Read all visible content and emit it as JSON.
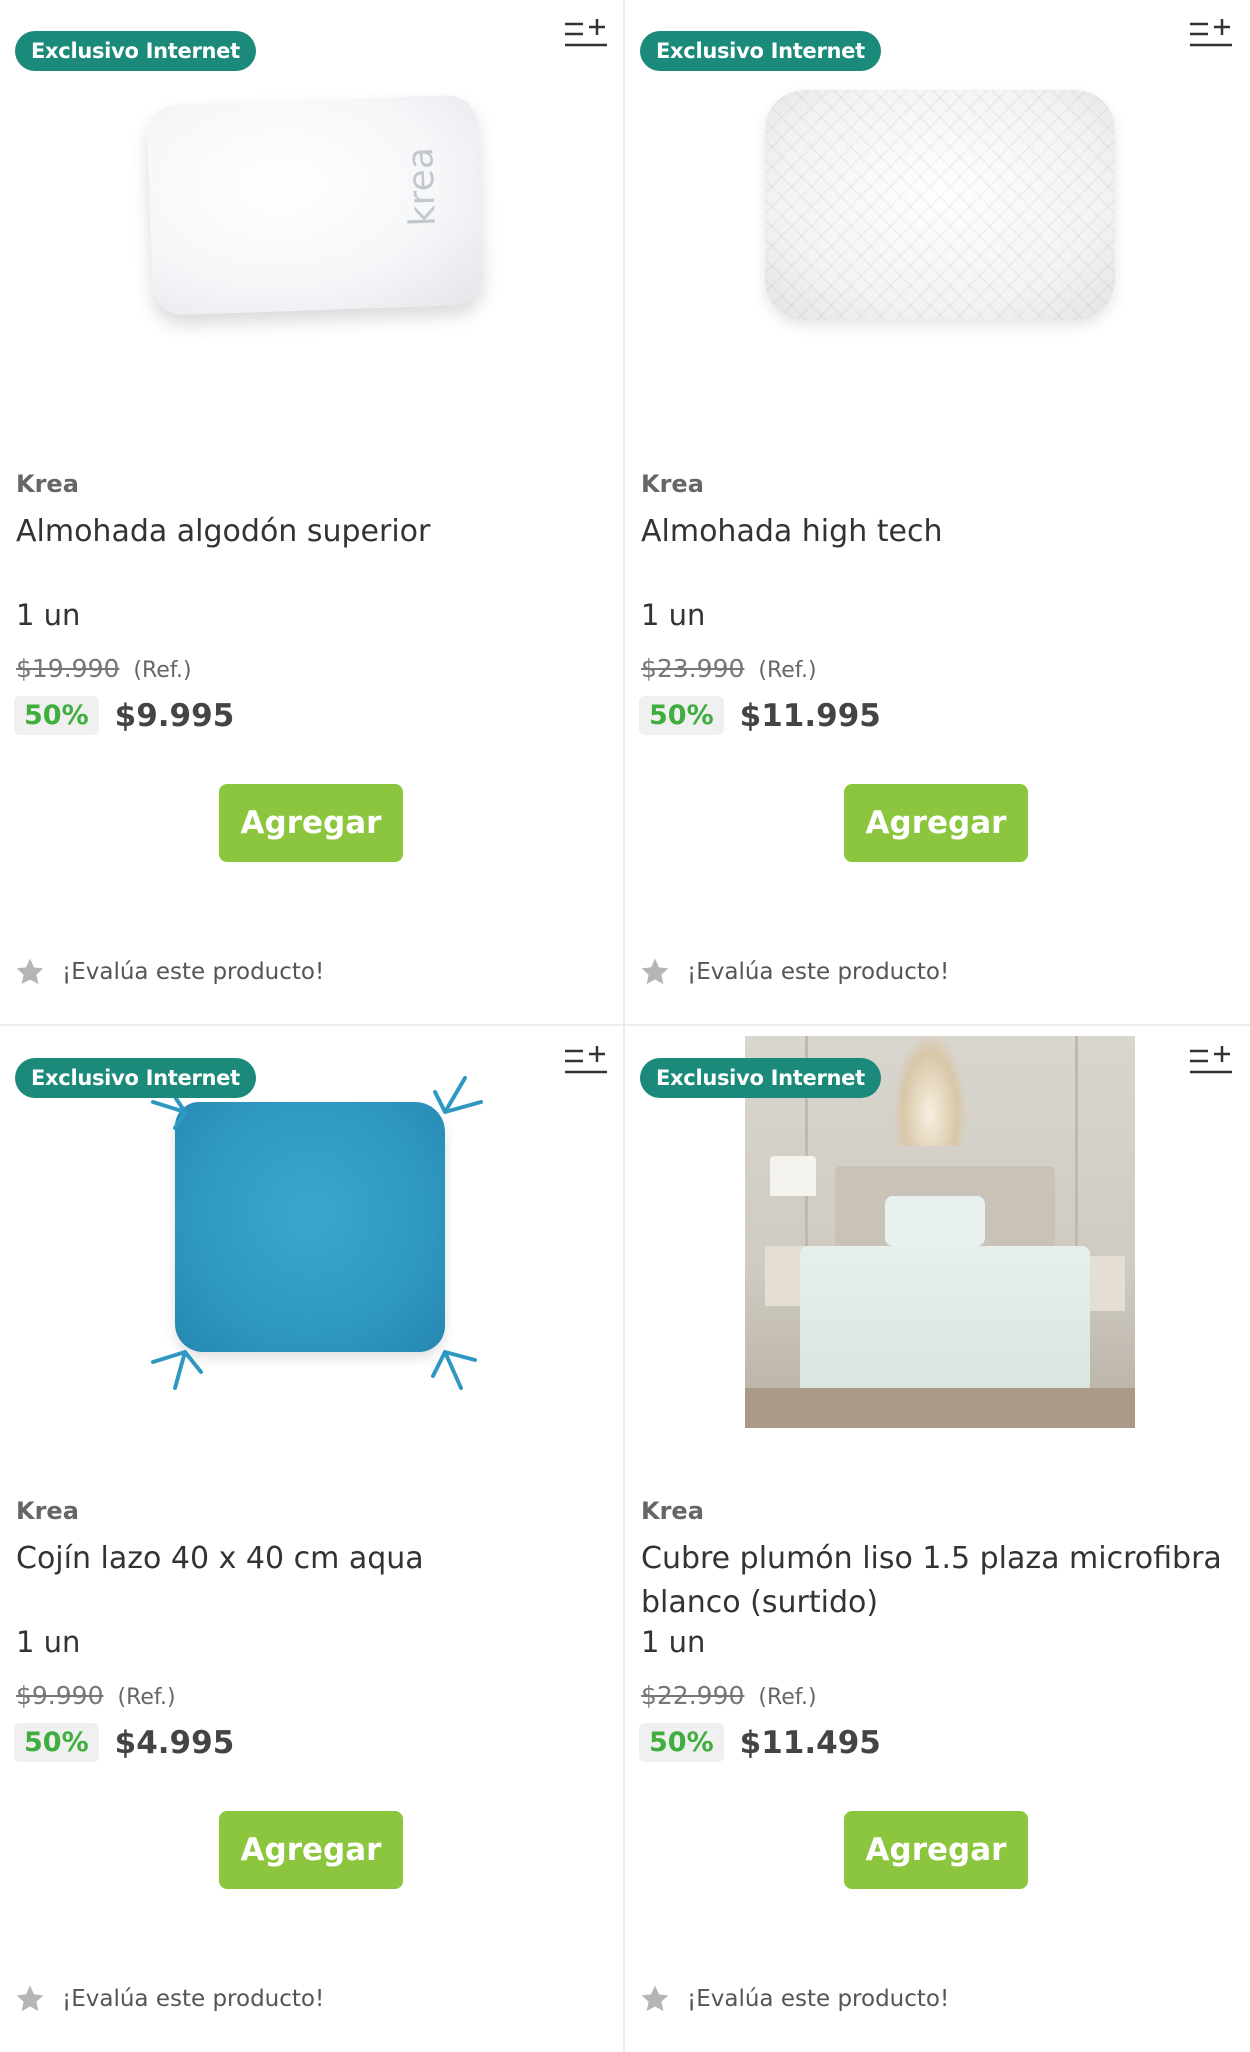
{
  "products": [
    {
      "badge": "Exclusivo Internet",
      "brand": "Krea",
      "name": "Almohada algodón superior",
      "unit": "1 un",
      "old_price": "$19.990",
      "ref": "(Ref.)",
      "discount": "50%",
      "price": "$9.995",
      "add_label": "Agregar",
      "rate_label": "¡Evalúa este producto!",
      "image_text": "krea",
      "image_icon": "pillow-image"
    },
    {
      "badge": "Exclusivo Internet",
      "brand": "Krea",
      "name": "Almohada high tech",
      "unit": "1 un",
      "old_price": "$23.990",
      "ref": "(Ref.)",
      "discount": "50%",
      "price": "$11.995",
      "add_label": "Agregar",
      "rate_label": "¡Evalúa este producto!",
      "image_icon": "quilted-pillow-image"
    },
    {
      "badge": "Exclusivo Internet",
      "brand": "Krea",
      "name": "Cojín lazo 40 x 40 cm aqua",
      "unit": "1 un",
      "old_price": "$9.990",
      "ref": "(Ref.)",
      "discount": "50%",
      "price": "$4.995",
      "add_label": "Agregar",
      "rate_label": "¡Evalúa este producto!",
      "image_icon": "aqua-cushion-image"
    },
    {
      "badge": "Exclusivo Internet",
      "brand": "Krea",
      "name": "Cubre plumón liso 1.5 plaza microfibra blanco (surtido)",
      "unit": "1 un",
      "old_price": "$22.990",
      "ref": "(Ref.)",
      "discount": "50%",
      "price": "$11.495",
      "add_label": "Agregar",
      "rate_label": "¡Evalúa este producto!",
      "image_icon": "bedroom-duvet-image"
    }
  ],
  "colors": {
    "badge_bg": "#1b8a7a",
    "button_bg": "#8cc63f",
    "discount_text": "#3fae3f",
    "star": "#b5b5b5"
  },
  "icons": {
    "compare": "compare-add-icon",
    "star": "star-icon"
  }
}
